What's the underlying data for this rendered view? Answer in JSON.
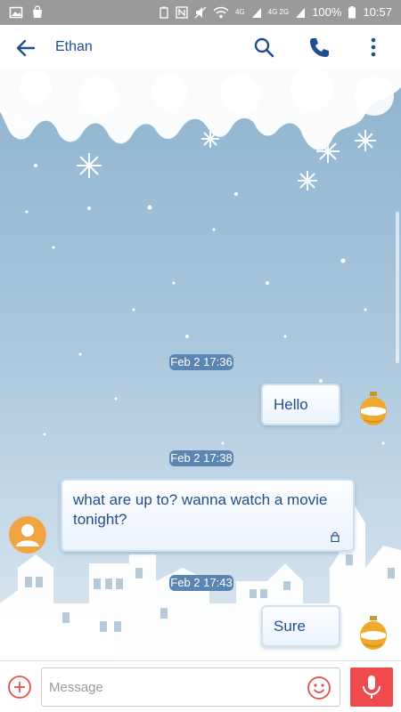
{
  "status_bar": {
    "network": "4G",
    "network2": "4G 2G",
    "battery": "100%",
    "time": "10:57"
  },
  "header": {
    "contact_name": "Ethan",
    "icons": [
      "back-arrow-icon",
      "search-icon",
      "phone-icon",
      "more-vert-icon"
    ]
  },
  "messages": [
    {
      "type": "timestamp",
      "text": "Feb 2 17:36"
    },
    {
      "type": "outgoing",
      "text": "Hello"
    },
    {
      "type": "timestamp",
      "text": "Feb 2 17:38"
    },
    {
      "type": "incoming",
      "text": "what are up to? wanna watch a movie tonight?"
    },
    {
      "type": "timestamp",
      "text": "Feb 2 17:43"
    },
    {
      "type": "outgoing",
      "text": "Sure"
    }
  ],
  "composer": {
    "placeholder": "Message",
    "icons": [
      "add-icon",
      "emoji-icon",
      "mic-icon"
    ]
  },
  "colors": {
    "accent": "#1f4e8f",
    "timestamp_chip": "#5b86b3",
    "mic_button": "#ef4b4e",
    "avatar": "#f2a443"
  }
}
